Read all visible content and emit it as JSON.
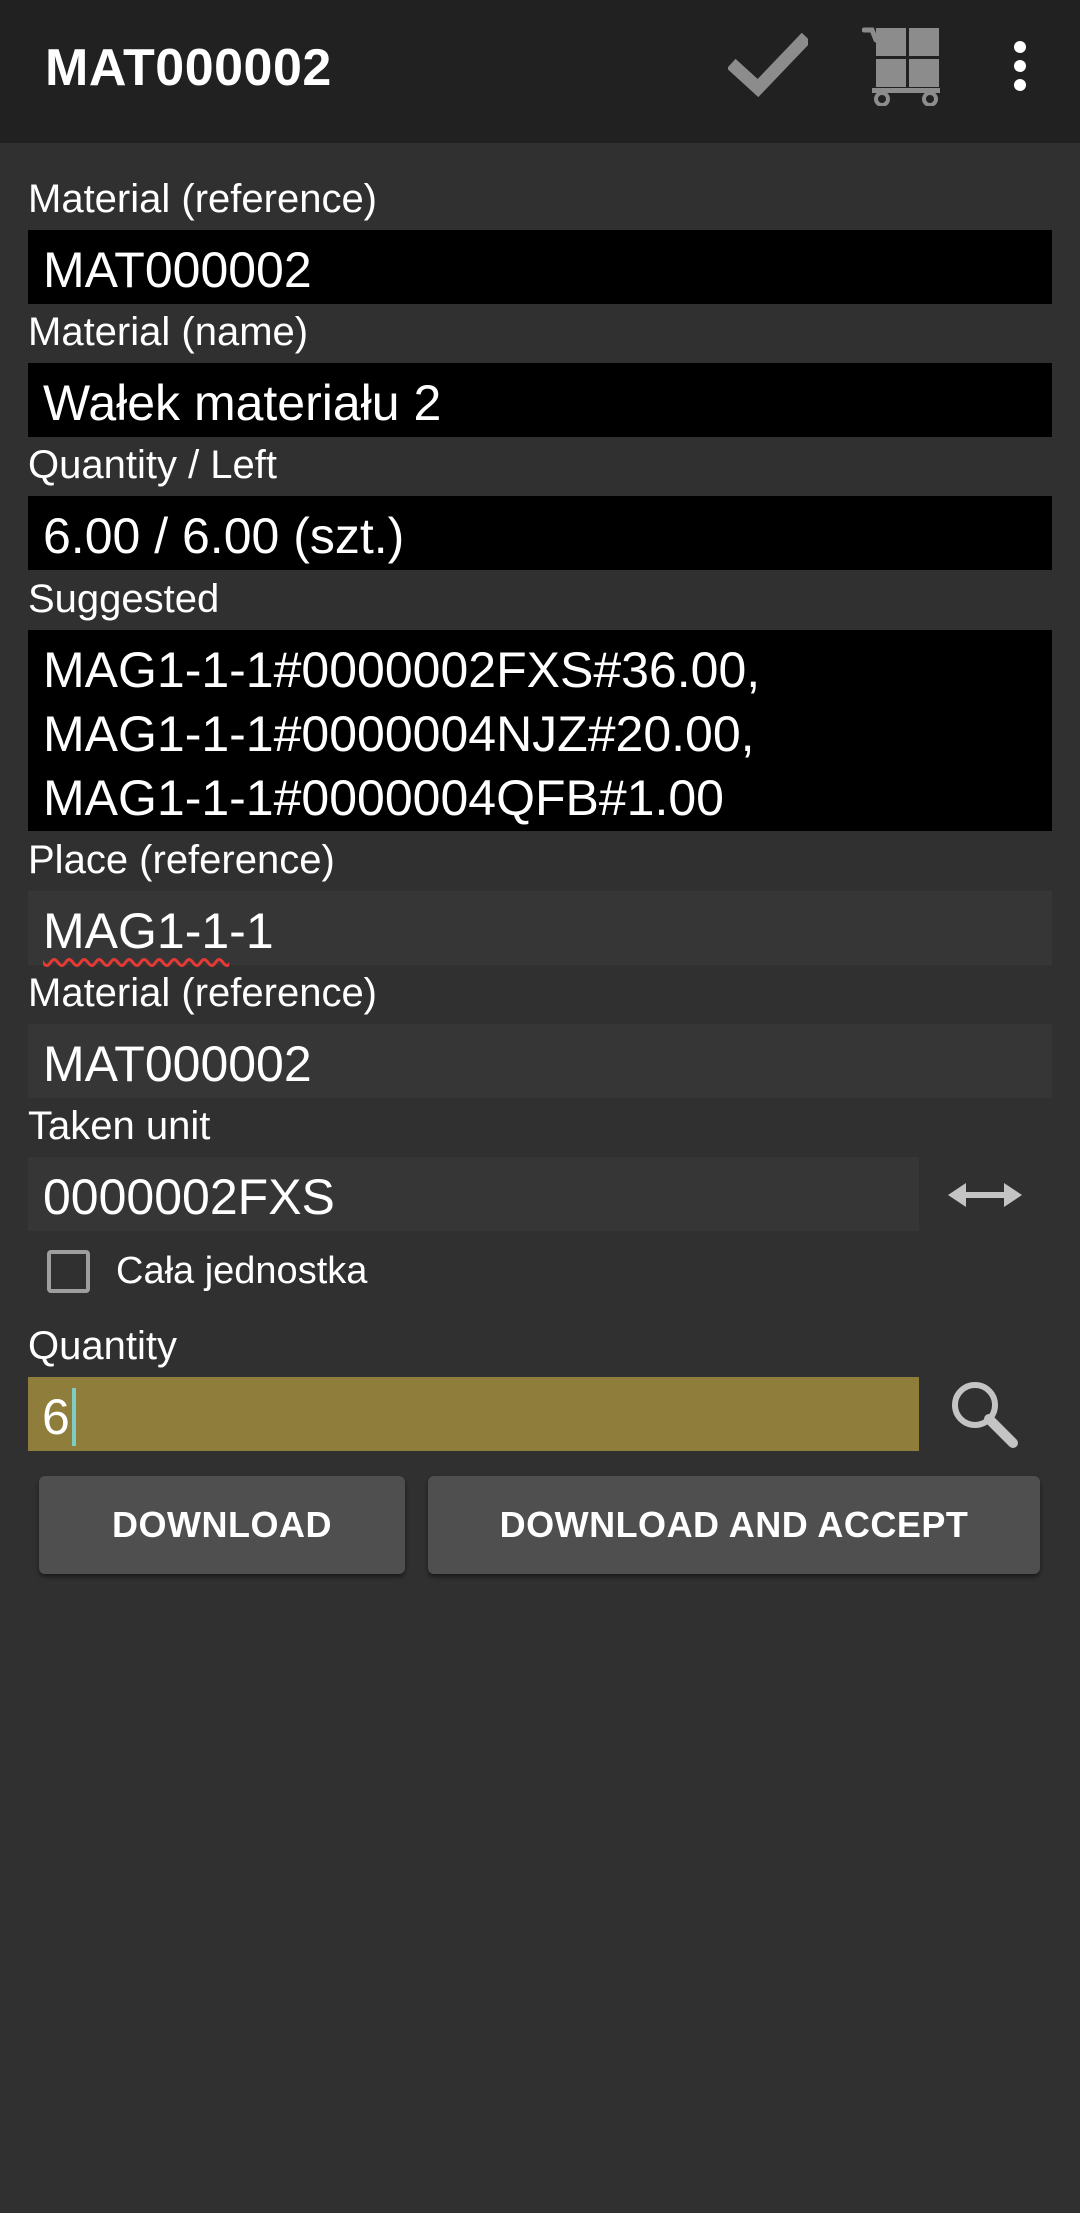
{
  "appbar": {
    "title": "MAT000002",
    "actions": [
      "check-icon",
      "cart-icon",
      "more-vert-icon"
    ]
  },
  "fields": {
    "material_reference": {
      "label": "Material (reference)",
      "value": "MAT000002"
    },
    "material_name": {
      "label": "Material (name)",
      "value": "Wałek materiału 2"
    },
    "quantity_left": {
      "label": "Quantity / Left",
      "value": "6.00 / 6.00 (szt.)"
    },
    "suggested": {
      "label": "Suggested",
      "lines": [
        "MAG1-1-1#0000002FXS#36.00,",
        "MAG1-1-1#0000004NJZ#20.00,",
        "MAG1-1-1#0000004QFB#1.00"
      ]
    },
    "place_reference": {
      "label": "Place (reference)",
      "value_underlined": "MAG1-1",
      "value_rest": "-1"
    },
    "material_reference_input": {
      "label": "Material (reference)",
      "value": "MAT000002"
    },
    "taken_unit": {
      "label": "Taken unit",
      "value": "0000002FXS"
    },
    "whole_unit": {
      "label": "Cała jednostka",
      "checked": false
    },
    "quantity": {
      "label": "Quantity",
      "value": "6"
    }
  },
  "buttons": {
    "download": "DOWNLOAD",
    "download_accept": "DOWNLOAD AND ACCEPT"
  },
  "colors": {
    "background": "#303030",
    "appbar": "#212121",
    "readonly_field": "#000000",
    "input_field": "#363636",
    "quantity_highlight": "#8f7d3b",
    "button": "#4f4f50",
    "spell_underline": "#e53935",
    "cursor": "#80cbc4"
  }
}
